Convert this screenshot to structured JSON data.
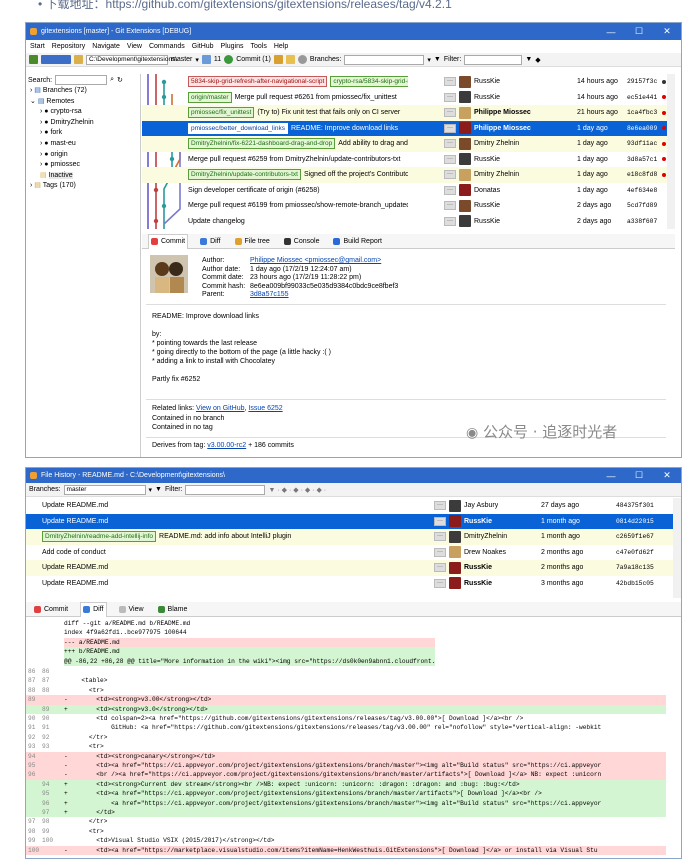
{
  "top_text": "• 下载地址：https://github.com/gitextensions/gitextensions/releases/tag/v4.2.1",
  "main": {
    "title": "gitextensions [master] - Git Extensions [DEBUG]",
    "menu": [
      "Start",
      "Repository",
      "Navigate",
      "View",
      "Commands",
      "GitHub",
      "Plugins",
      "Tools",
      "Help"
    ],
    "toolbar": {
      "path": "C:\\Development\\gitextensions\\",
      "branch": "master",
      "count": "11",
      "commit": "Commit (1)",
      "branches_label": "Branches:",
      "filter_label": "Filter:"
    },
    "tree": {
      "search_label": "Search:",
      "branches": "Branches (72)",
      "remotes": "Remotes",
      "remote_items": [
        "crypto-rsa",
        "DmitryZhelnin",
        "fork",
        "mast-eu",
        "origin",
        "pmiossec",
        "Inactive"
      ],
      "tags": "Tags (170)"
    },
    "commits": [
      {
        "refs": [
          {
            "t": "5834-skip-grid-refresh-after-navigational-script",
            "c": "red"
          },
          {
            "t": "crypto-rsa/5834-skip-grid-refresh...",
            "c": "green"
          }
        ],
        "msg": "",
        "author": "RussKie",
        "date": "14 hours ago",
        "hash": "29157f3c",
        "dot": "#333"
      },
      {
        "refs": [
          {
            "t": "origin/master",
            "c": "green"
          }
        ],
        "msg": "Merge pull request #6261 from pmiossec/fix_unittest",
        "author": "RussKie",
        "date": "14 hours ago",
        "hash": "ec51e441",
        "dot": "#e00000"
      },
      {
        "refs": [
          {
            "t": "pmiossec/fix_unittest",
            "c": "green"
          }
        ],
        "msg": "(Try to) Fix unit test that fails only on CI server",
        "author": "Philippe Miossec",
        "date": "21 hours ago",
        "hash": "1ca4fbc3",
        "dot": "#e00000"
      },
      {
        "refs": [
          {
            "t": "pmiossec/better_download_links",
            "c": "green"
          }
        ],
        "msg": "README: Improve download links",
        "author": "Philippe Miossec",
        "date": "1 day ago",
        "hash": "8e6ea009",
        "dot": "#e00000",
        "selected": true
      },
      {
        "refs": [
          {
            "t": "DmitryZhelnin/fix-6221-dashboard-drag-and-drop",
            "c": "green"
          }
        ],
        "msg": "Add ability to drag and drop a f...",
        "author": "Dmitry Zhelnin",
        "date": "1 day ago",
        "hash": "93df11ac",
        "dot": "#e00000"
      },
      {
        "refs": [],
        "msg": "Merge pull request #6259 from DmitryZhelnin/update-contributors-txt",
        "author": "RussKie",
        "date": "1 day ago",
        "hash": "3d8a57c1",
        "dot": "#e00000"
      },
      {
        "refs": [
          {
            "t": "DmitryZhelnin/update-contributors-txt",
            "c": "green"
          }
        ],
        "msg": "Signed off the project's Contributors Certific...",
        "author": "Dmitry Zhelnin",
        "date": "1 day ago",
        "hash": "e18c8fd8",
        "dot": "#e00000"
      },
      {
        "refs": [],
        "msg": "Sign developer certificate of origin (#6258)",
        "author": "Donatas",
        "date": "1 day ago",
        "hash": "4ef634e8",
        "dot": ""
      },
      {
        "refs": [],
        "msg": "Merge pull request #6199 from pmiossec/show-remote-branch_updated",
        "author": "RussKie",
        "date": "2 days ago",
        "hash": "5cd7fd89",
        "dot": ""
      },
      {
        "refs": [],
        "msg": "Update changelog",
        "author": "RussKie",
        "date": "2 days ago",
        "hash": "a338f607",
        "dot": ""
      }
    ],
    "tabs": [
      "Commit",
      "Diff",
      "File tree",
      "Console",
      "Build Report"
    ],
    "detail": {
      "labels": [
        "Author:",
        "Author date:",
        "Commit date:",
        "Commit hash:",
        "Parent:"
      ],
      "values": [
        "Philippe Miossec <pmiossec@gmail.com>",
        "1 day ago (17/2/19 12:24:07 am)",
        "23 hours ago (17/2/19 11:28:22 pm)",
        "8e6ea009bf99033c5e035d9384c0bdc9ce8fbef3",
        "3d8a57c155"
      ],
      "message": [
        "README: Improve download links",
        "",
        "by:",
        "* pointing towards the last release",
        "* going directly to the bottom of the page (a little hacky :( )",
        "* adding a link to install with Chocolatey",
        "",
        "Partly fix #6252"
      ],
      "related_label": "Related links:",
      "link1": "View on GitHub",
      "link2": "Issue 6252",
      "branch_info": "Contained in no branch",
      "tag_info": "Contained in no tag",
      "derives_label": "Derives from tag:",
      "derives_tag": "v3.00.00-rc2",
      "derives_rest": " + 186 commits"
    }
  },
  "watermark": "公众号 · 追逐时光者",
  "history": {
    "title": "File History - README.md - C:\\Development\\gitextensions\\",
    "branches_label": "Branches:",
    "branch": "master",
    "filter_label": "Filter:",
    "commits": [
      {
        "refs": [],
        "msg": "Update README.md",
        "author": "Jay Asbury",
        "date": "27 days ago",
        "hash": "484375f301"
      },
      {
        "refs": [],
        "msg": "Update README.md",
        "author": "RussKie",
        "date": "1 month ago",
        "hash": "0814d22015",
        "selected": true
      },
      {
        "refs": [
          "DmitryZhelnin/readme-add-intellij-info"
        ],
        "msg": "README.md: add info about IntelliJ plugin",
        "author": "DmitryZhelnin",
        "date": "1 month ago",
        "hash": "c2659f1e67"
      },
      {
        "refs": [],
        "msg": "Add code of conduct",
        "author": "Drew Noakes",
        "date": "2 months ago",
        "hash": "c47e0fd62f"
      },
      {
        "refs": [],
        "msg": "Update README.md",
        "author": "RussKie",
        "date": "2 months ago",
        "hash": "7a9a18c135"
      },
      {
        "refs": [],
        "msg": "Update README.md",
        "author": "RussKie",
        "date": "3 months ago",
        "hash": "42bdb15c05"
      }
    ],
    "tabs": [
      "Commit",
      "Diff",
      "View",
      "Blame"
    ],
    "diff_header": [
      "diff --git a/README.md b/README.md",
      "index 4f9a62fd1..bce977975 100644",
      "--- a/README.md",
      "+++ b/README.md",
      "@@ -86,22 +86,28 @@ title=\"More information in the wiki\"><img src=\"https://ds0k0en9abnn1.cloudfront."
    ],
    "diff_lines": [
      {
        "a": "86",
        "b": "86",
        "s": " ",
        "t": ""
      },
      {
        "a": "87",
        "b": "87",
        "s": " ",
        "t": "  <table>"
      },
      {
        "a": "88",
        "b": "88",
        "s": " ",
        "t": "    <tr>"
      },
      {
        "a": "89",
        "b": "",
        "s": "-",
        "t": "      <td><strong>v3.00</strong></td>",
        "k": "del"
      },
      {
        "a": "",
        "b": "89",
        "s": "+",
        "t": "      <td><strong>v3.0</strong></td>",
        "k": "add"
      },
      {
        "a": "90",
        "b": "90",
        "s": " ",
        "t": "      <td colspan=2><a href=\"https://github.com/gitextensions/gitextensions/releases/tag/v3.00.00\">[ Download ]</a><br />"
      },
      {
        "a": "91",
        "b": "91",
        "s": " ",
        "t": "          GitHub: <a href=\"https://github.com/gitextensions/gitextensions/releases/tag/v3.00.00\" rel=\"nofollow\" style=\"vertical-align: -webkit"
      },
      {
        "a": "92",
        "b": "92",
        "s": " ",
        "t": "    </tr>"
      },
      {
        "a": "93",
        "b": "93",
        "s": " ",
        "t": "    <tr>"
      },
      {
        "a": "94",
        "b": "",
        "s": "-",
        "t": "      <td><strong>canary</strong></td>",
        "k": "del"
      },
      {
        "a": "95",
        "b": "",
        "s": "-",
        "t": "      <td><a href=\"https://ci.appveyor.com/project/gitextensions/gitextensions/branch/master\"><img alt=\"Build status\" src=\"https://ci.appveyor",
        "k": "del"
      },
      {
        "a": "96",
        "b": "",
        "s": "-",
        "t": "      <br /><a href=\"https://ci.appveyor.com/project/gitextensions/gitextensions/branch/master/artifacts\">[ Download ]</a> NB: expect :unicorn",
        "k": "del"
      },
      {
        "a": "",
        "b": "94",
        "s": "+",
        "t": "      <td><strong>Current dev stream</strong><br />NB: expect :unicorn: :unicorn: :dragon: :dragon: and :bug: :bug:</td>",
        "k": "add"
      },
      {
        "a": "",
        "b": "95",
        "s": "+",
        "t": "      <td><a href=\"https://ci.appveyor.com/project/gitextensions/gitextensions/branch/master/artifacts\">[ Download ]</a><br />",
        "k": "add"
      },
      {
        "a": "",
        "b": "96",
        "s": "+",
        "t": "          <a href=\"https://ci.appveyor.com/project/gitextensions/gitextensions/branch/master\"><img alt=\"Build status\" src=\"https://ci.appveyor",
        "k": "add"
      },
      {
        "a": "",
        "b": "97",
        "s": "+",
        "t": "      </td>",
        "k": "add"
      },
      {
        "a": "97",
        "b": "98",
        "s": " ",
        "t": "    </tr>"
      },
      {
        "a": "98",
        "b": "99",
        "s": " ",
        "t": "    <tr>"
      },
      {
        "a": "99",
        "b": "100",
        "s": " ",
        "t": "      <td>Visual Studio VSIX (2015/2017)</strong></td>"
      },
      {
        "a": "100",
        "b": "",
        "s": "-",
        "t": "      <td><a href=\"https://marketplace.visualstudio.com/items?itemName=HenkWesthuis.GitExtensions\">[ Download ]</a> or install via Visual Stu",
        "k": "del"
      }
    ]
  }
}
